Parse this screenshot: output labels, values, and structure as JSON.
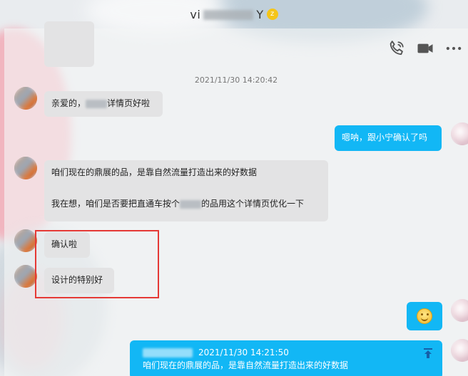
{
  "window": {
    "title_prefix": "vi",
    "title_suffix": "Y",
    "title_badge": "z"
  },
  "toolbar": {
    "icons": [
      "phone-icon",
      "video-icon",
      "more-icon"
    ]
  },
  "chat": {
    "timestamp": "2021/11/30 14:20:42",
    "messages": [
      {
        "side": "in",
        "text_pre": "亲爱的，",
        "text_post": "详情页好啦"
      },
      {
        "side": "out",
        "text": "嗯呐，跟小宁确认了吗"
      },
      {
        "side": "in",
        "line1": "咱们现在的鼎展的品，是靠自然流量打造出来的好数据",
        "line2_pre": "我在想，咱们是否要把直通车按个",
        "line2_post": "的品用这个详情页优化一下"
      },
      {
        "side": "in",
        "text": "确认啦"
      },
      {
        "side": "in",
        "text": "设计的特别好"
      },
      {
        "side": "out",
        "emoji": "smile-emoji"
      },
      {
        "side": "out",
        "quote_time": "2021/11/30 14:21:50",
        "quote_text": "咱们现在的鼎展的品，是靠自然流量打造出来的好数据"
      }
    ]
  },
  "colors": {
    "outgoing_bubble": "#12b7f5",
    "incoming_bubble": "#e3e3e4",
    "highlight_box": "#e53935"
  }
}
